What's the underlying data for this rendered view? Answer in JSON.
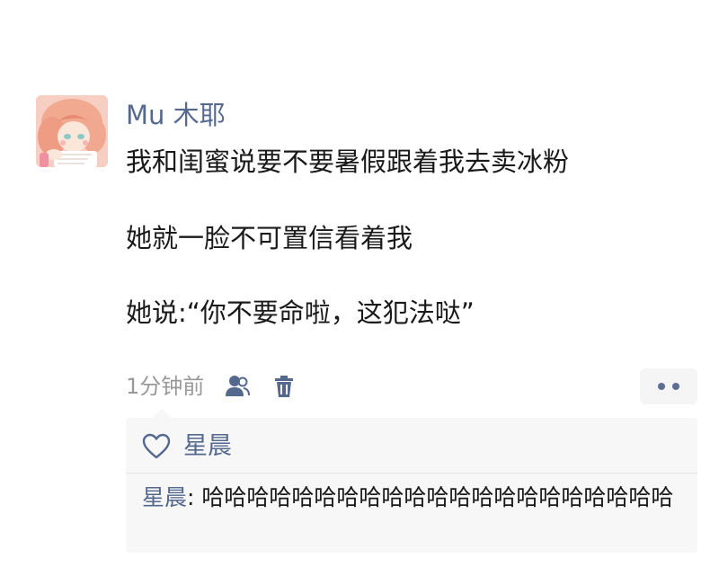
{
  "post": {
    "author": "Mu 木耶",
    "lines": [
      "我和闺蜜说要不要暑假跟着我去卖冰粉",
      "她就一脸不可置信看着我",
      "她说:“你不要命啦，这犯法哒”"
    ],
    "timestamp": "1分钟前",
    "icons": {
      "visibility": "people-icon",
      "delete": "trash-icon",
      "more": "more-dots-icon",
      "like": "heart-icon"
    }
  },
  "interactions": {
    "likes": [
      "星晨"
    ],
    "comments": [
      {
        "author": "星晨",
        "separator": ": ",
        "text": "哈哈哈哈哈哈哈哈哈哈哈哈哈哈哈哈哈哈哈哈哈"
      }
    ]
  },
  "colors": {
    "name_link": "#55698f",
    "timestamp": "#999999",
    "panel_background": "#f7f7f7",
    "more_dots": "#5e6f93"
  }
}
